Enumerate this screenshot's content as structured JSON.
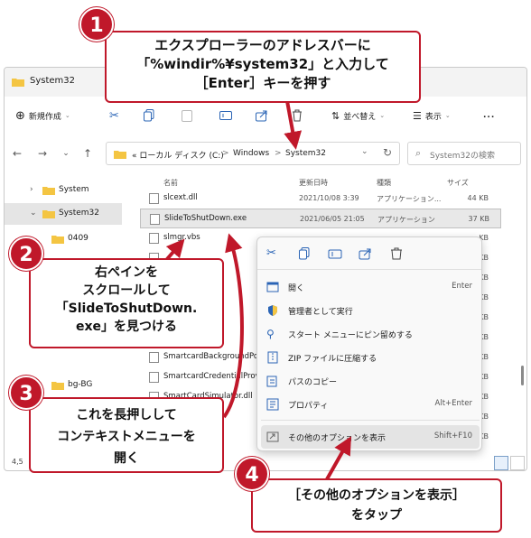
{
  "window": {
    "title": "System32"
  },
  "toolbar": {
    "new_label": "新規作成",
    "sort_label": "並べ替え",
    "view_label": "表示",
    "more_label": "..."
  },
  "address": {
    "crumbs": [
      "« ローカル ディスク (C:)",
      ">",
      "Windows",
      ">",
      "System32"
    ],
    "search_placeholder": "System32の検索"
  },
  "sidebar": {
    "items": [
      {
        "label": "System"
      },
      {
        "label": "System32"
      },
      {
        "label": "0409"
      },
      {
        "label": "bg-BG"
      }
    ]
  },
  "filelist": {
    "headers": {
      "name": "名前",
      "date": "更新日時",
      "type": "種類",
      "size": "サイズ"
    },
    "rows": [
      {
        "name": "slcext.dll",
        "date": "2021/10/08 3:39",
        "type": "アプリケーション...",
        "size": "44 KB"
      },
      {
        "name": "SlideToShutDown.exe",
        "date": "2021/06/05 21:05",
        "type": "アプリケーション",
        "size": "37 KB"
      },
      {
        "name": "slmgr.vbs",
        "date": "",
        "type": "",
        "size": "KB"
      },
      {
        "name": "",
        "date": "",
        "type": "",
        "size": "KB"
      },
      {
        "name": "",
        "date": "",
        "type": "",
        "size": "KB"
      },
      {
        "name": "",
        "date": "",
        "type": "",
        "size": "KB"
      },
      {
        "name": "",
        "date": "",
        "type": "",
        "size": "KB"
      },
      {
        "name": "",
        "date": "",
        "type": "",
        "size": "KB"
      },
      {
        "name": "SmartcardBackgroundPolicy...",
        "date": "",
        "type": "",
        "size": "KB"
      },
      {
        "name": "SmartcardCredentialProvider...",
        "date": "",
        "type": "",
        "size": "KB"
      },
      {
        "name": "SmartCardSimulator.dll",
        "date": "",
        "type": "",
        "size": "KB"
      },
      {
        "name": "",
        "date": "",
        "type": "",
        "size": "KB"
      },
      {
        "name": "",
        "date": "",
        "type": "",
        "size": "KB"
      }
    ]
  },
  "status": {
    "count": "4,5"
  },
  "context_menu": {
    "icon_actions": [
      "cut",
      "copy",
      "rename",
      "share",
      "delete"
    ],
    "items": [
      {
        "label": "開く",
        "shortcut": "Enter"
      },
      {
        "label": "管理者として実行",
        "shortcut": ""
      },
      {
        "label": "スタート メニューにピン留めする",
        "shortcut": ""
      },
      {
        "label": "ZIP ファイルに圧縮する",
        "shortcut": ""
      },
      {
        "label": "パスのコピー",
        "shortcut": ""
      },
      {
        "label": "プロパティ",
        "shortcut": "Alt+Enter"
      },
      {
        "label": "その他のオプションを表示",
        "shortcut": "Shift+F10"
      }
    ]
  },
  "annotations": {
    "step1": {
      "number": "1",
      "lines": [
        "エクスプローラーのアドレスバーに",
        "「%windir%¥system32」と入力して",
        "［Enter］キーを押す"
      ]
    },
    "step2": {
      "number": "2",
      "lines": [
        "右ペインを",
        "スクロールして",
        "「SlideToShutDown.",
        "exe」を見つける"
      ]
    },
    "step3": {
      "number": "3",
      "lines": [
        "これを長押しして",
        "コンテキストメニューを",
        "開く"
      ]
    },
    "step4": {
      "number": "4",
      "lines": [
        "［その他のオプションを表示］",
        "をタップ"
      ]
    }
  },
  "colors": {
    "accent_red": "#c0182a",
    "folder_yellow": "#f4c542",
    "selection_gray": "#e5e5e5"
  }
}
